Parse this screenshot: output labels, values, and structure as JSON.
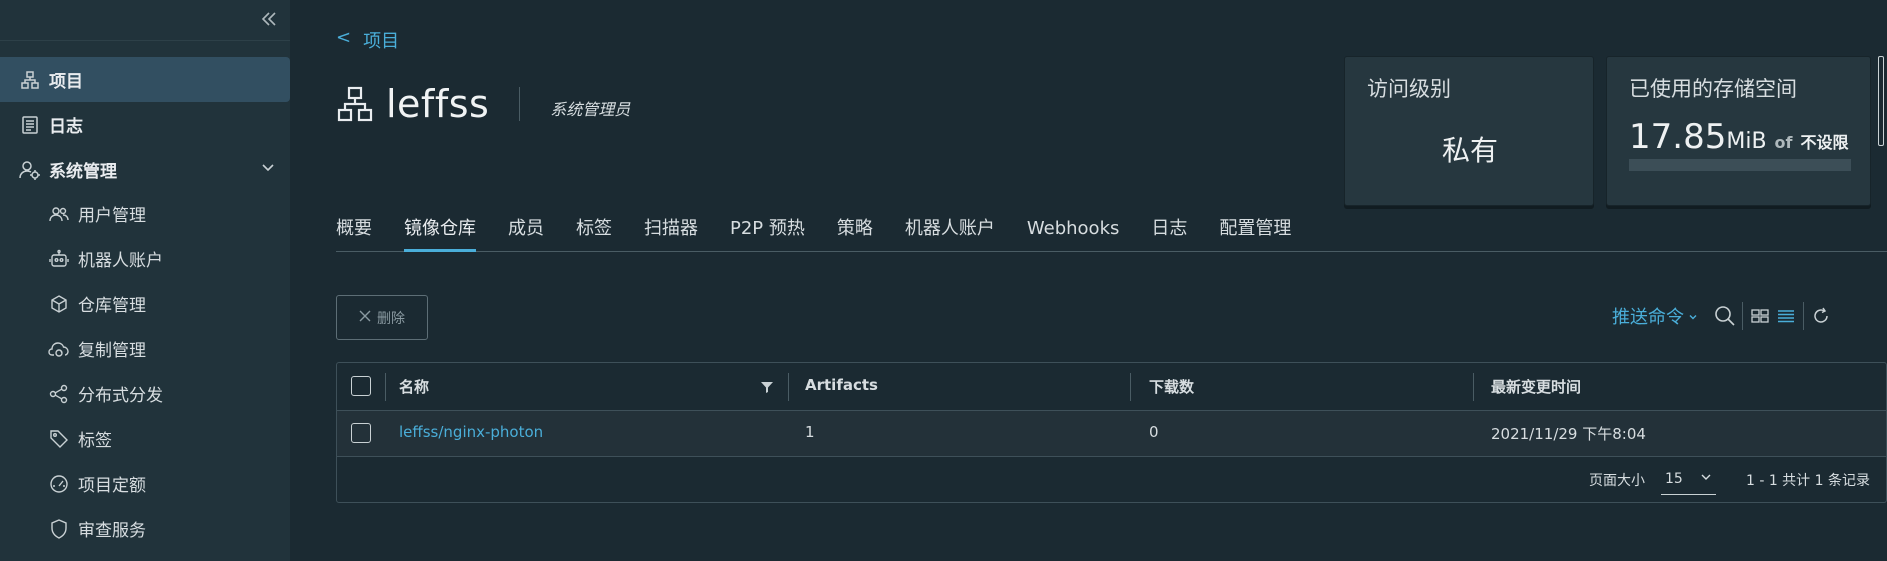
{
  "sidebar": {
    "items": [
      {
        "label": "项目",
        "icon": "project-icon",
        "active": true
      },
      {
        "label": "日志",
        "icon": "log-icon"
      },
      {
        "label": "系统管理",
        "icon": "admin-icon",
        "expanded": true
      }
    ],
    "subitems": [
      {
        "label": "用户管理",
        "icon": "users-icon"
      },
      {
        "label": "机器人账户",
        "icon": "robot-icon"
      },
      {
        "label": "仓库管理",
        "icon": "registry-icon"
      },
      {
        "label": "复制管理",
        "icon": "cloud-sync-icon"
      },
      {
        "label": "分布式分发",
        "icon": "share-icon"
      },
      {
        "label": "标签",
        "icon": "tag-icon"
      },
      {
        "label": "项目定额",
        "icon": "dashboard-icon"
      },
      {
        "label": "审查服务",
        "icon": "shield-icon"
      }
    ]
  },
  "breadcrumb": {
    "arrow": "<",
    "label": "项目"
  },
  "project": {
    "name": "leffss",
    "role": "系统管理员"
  },
  "cards": {
    "access": {
      "title": "访问级别",
      "value": "私有"
    },
    "storage": {
      "title": "已使用的存储空间",
      "amount": "17.85",
      "unit": "MiB",
      "of": "of",
      "limit": "不设限",
      "usage_fraction": 0
    }
  },
  "tabs": [
    "概要",
    "镜像仓库",
    "成员",
    "标签",
    "扫描器",
    "P2P 预热",
    "策略",
    "机器人账户",
    "Webhooks",
    "日志",
    "配置管理"
  ],
  "active_tab": "镜像仓库",
  "toolbar": {
    "delete_label": "删除",
    "push_label": "推送命令"
  },
  "table": {
    "headers": [
      "名称",
      "Artifacts",
      "下载数",
      "最新变更时间"
    ],
    "rows": [
      {
        "name": "leffss/nginx-photon",
        "artifacts": "1",
        "pulls": "0",
        "updated": "2021/11/29 下午8:04"
      }
    ]
  },
  "pagination": {
    "page_size_label": "页面大小",
    "page_size": "15",
    "info": "1 - 1 共计 1 条记录"
  },
  "colors": {
    "accent": "#4aaed9",
    "background": "#1b2a32",
    "sidebar": "#21333b",
    "active_nav": "#324f61"
  }
}
